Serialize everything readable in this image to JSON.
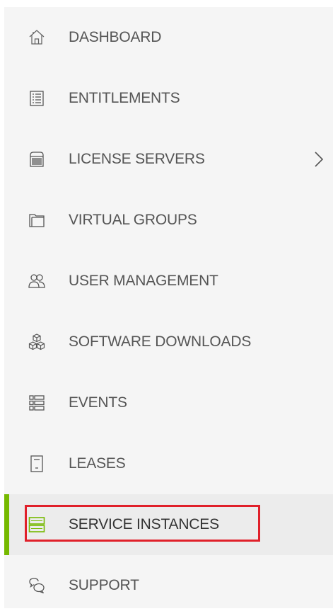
{
  "sidebar": {
    "accent_color": "#76b900",
    "highlight_color": "#e0202a",
    "items": [
      {
        "label": "DASHBOARD",
        "icon": "home-icon"
      },
      {
        "label": "ENTITLEMENTS",
        "icon": "list-document-icon"
      },
      {
        "label": "LICENSE SERVERS",
        "icon": "server-icon",
        "expandable": true
      },
      {
        "label": "VIRTUAL GROUPS",
        "icon": "folder-icon"
      },
      {
        "label": "USER MANAGEMENT",
        "icon": "users-icon"
      },
      {
        "label": "SOFTWARE DOWNLOADS",
        "icon": "cubes-icon"
      },
      {
        "label": "EVENTS",
        "icon": "event-list-icon"
      },
      {
        "label": "LEASES",
        "icon": "document-icon"
      },
      {
        "label": "SERVICE INSTANCES",
        "icon": "service-instances-icon",
        "active": true
      },
      {
        "label": "SUPPORT",
        "icon": "chat-support-icon"
      }
    ]
  }
}
